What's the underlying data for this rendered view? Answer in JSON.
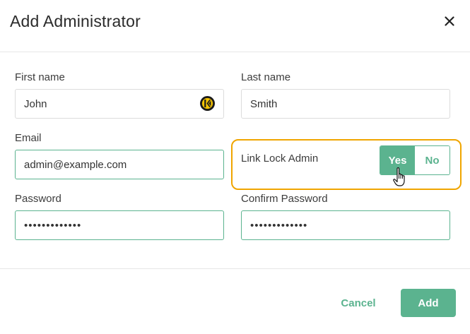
{
  "dialog": {
    "title": "Add Administrator",
    "close_icon": "close-icon"
  },
  "form": {
    "first_name": {
      "label": "First name",
      "value": "John",
      "icon": "keeper-logo-icon"
    },
    "last_name": {
      "label": "Last name",
      "value": "Smith"
    },
    "email": {
      "label": "Email",
      "value": "admin@example.com"
    },
    "link_lock_admin": {
      "label": "Link Lock Admin",
      "yes_label": "Yes",
      "no_label": "No",
      "selected": "Yes"
    },
    "password": {
      "label": "Password",
      "value": "•••••••••••••"
    },
    "confirm_password": {
      "label": "Confirm Password",
      "value": "•••••••••••••"
    }
  },
  "footer": {
    "cancel_label": "Cancel",
    "add_label": "Add"
  },
  "colors": {
    "accent": "#5bb38f",
    "highlight": "#f0a500",
    "keeper_yellow": "#f5c400"
  }
}
